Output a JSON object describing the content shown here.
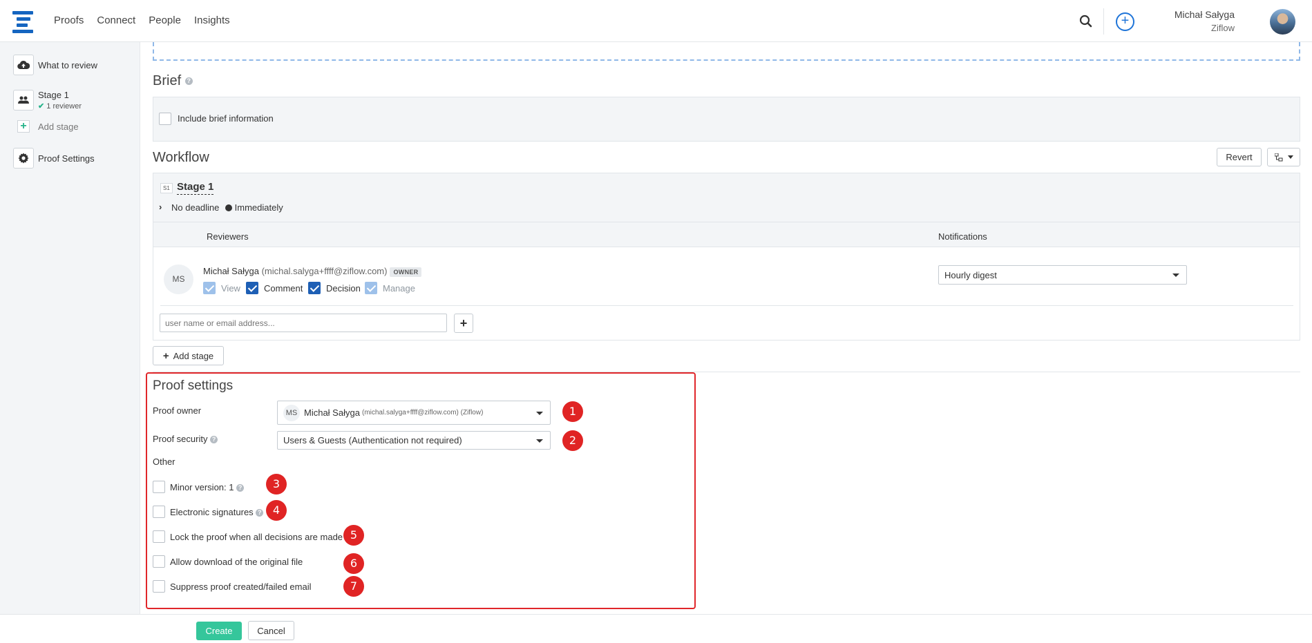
{
  "nav": {
    "items": [
      "Proofs",
      "Connect",
      "People",
      "Insights"
    ]
  },
  "user": {
    "name": "Michał Sałyga",
    "org": "Ziflow"
  },
  "sidebar": {
    "what_to_review": "What to review",
    "stage_label": "Stage 1",
    "stage_sub": "1 reviewer",
    "add_stage": "Add stage",
    "proof_settings": "Proof Settings"
  },
  "brief": {
    "title": "Brief",
    "checkbox_label": "Include brief information"
  },
  "workflow": {
    "title": "Workflow",
    "revert": "Revert",
    "stage_badge": "S1",
    "stage_name": "Stage 1",
    "deadline": "No deadline",
    "start": "Immediately",
    "col_reviewers": "Reviewers",
    "col_notifications": "Notifications",
    "reviewer": {
      "initials": "MS",
      "name": "Michał Sałyga",
      "email": "(michal.salyga+ffff@ziflow.com)",
      "role": "OWNER",
      "perms": [
        {
          "label": "View",
          "checked": true,
          "disabled": true
        },
        {
          "label": "Comment",
          "checked": true,
          "disabled": false
        },
        {
          "label": "Decision",
          "checked": true,
          "disabled": false
        },
        {
          "label": "Manage",
          "checked": true,
          "disabled": true
        }
      ],
      "notification": "Hourly digest"
    },
    "add_placeholder": "user name or email address...",
    "add_stage": "Add stage"
  },
  "proof_settings": {
    "title": "Proof settings",
    "owner_label": "Proof owner",
    "owner_initials": "MS",
    "owner_name": "Michał Sałyga",
    "owner_detail": "(michal.salyga+ffff@ziflow.com) (Ziflow)",
    "security_label": "Proof security",
    "security_value": "Users & Guests (Authentication not required)",
    "other_label": "Other",
    "options": [
      "Minor version: 1",
      "Electronic signatures",
      "Lock the proof when all decisions are made",
      "Allow download of the original file",
      "Suppress proof created/failed email"
    ],
    "markers": [
      "1",
      "2",
      "3",
      "4",
      "5",
      "6",
      "7"
    ]
  },
  "footer": {
    "create": "Create",
    "cancel": "Cancel"
  },
  "colors": {
    "primary": "#1e5fb5",
    "accent_green": "#35c69b",
    "highlight_red": "#e0262a"
  }
}
